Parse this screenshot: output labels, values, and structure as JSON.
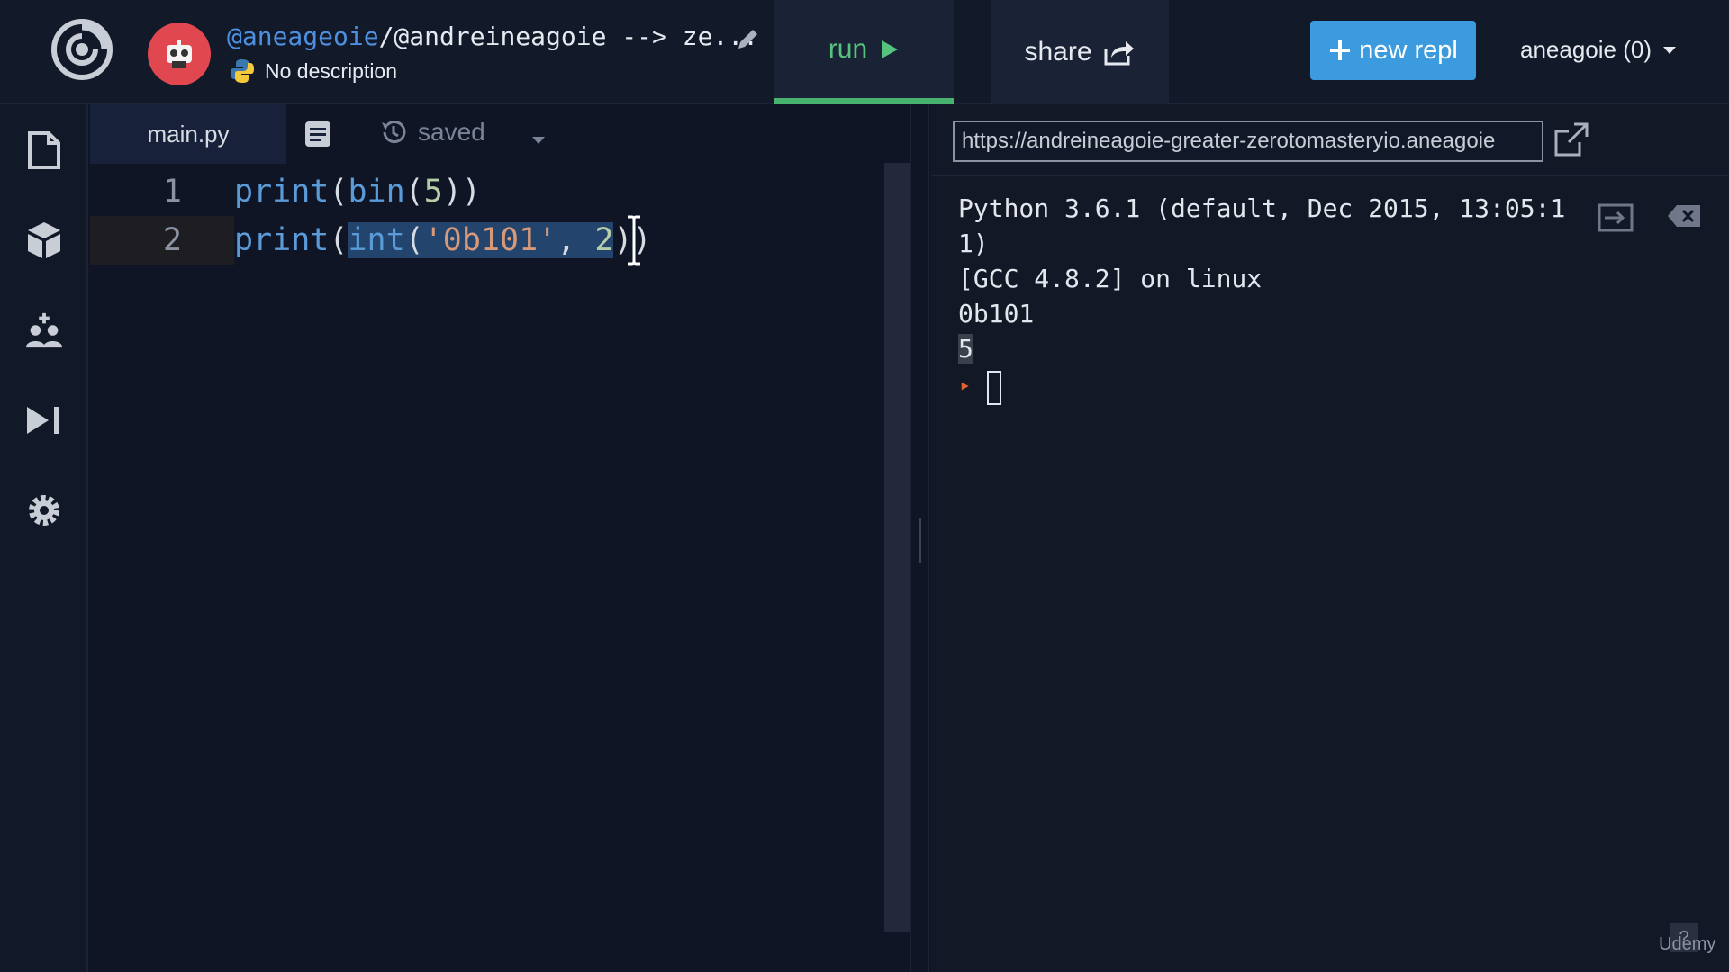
{
  "header": {
    "owner": "@aneageoie",
    "repl_path": "/@andreineagoie --> ze...",
    "description": "No description",
    "run_label": "run",
    "share_label": "share",
    "new_repl_label": "new repl",
    "user_label": "aneagoie (0)"
  },
  "sidebar": {
    "items": [
      "files-icon",
      "packages-icon",
      "multiplayer-icon",
      "debugger-icon",
      "settings-icon"
    ]
  },
  "editor": {
    "filename": "main.py",
    "status": "saved",
    "lines": [
      {
        "no": "1",
        "text": "print(bin(5))"
      },
      {
        "no": "2",
        "text": "print(int('0b101', 2))"
      }
    ]
  },
  "console": {
    "url": "https://andreineagoie-greater-zerotomasteryio.aneagoie",
    "output": [
      "Python 3.6.1 (default, Dec 2015, 13:05:1",
      "1)",
      "[GCC 4.8.2] on linux",
      "0b101",
      "5"
    ]
  },
  "watermark": "Udemy",
  "colors": {
    "run_green": "#56c27e",
    "accent_blue": "#3c9bde",
    "avatar_red": "#e0474f",
    "prompt_orange": "#e2612f"
  }
}
